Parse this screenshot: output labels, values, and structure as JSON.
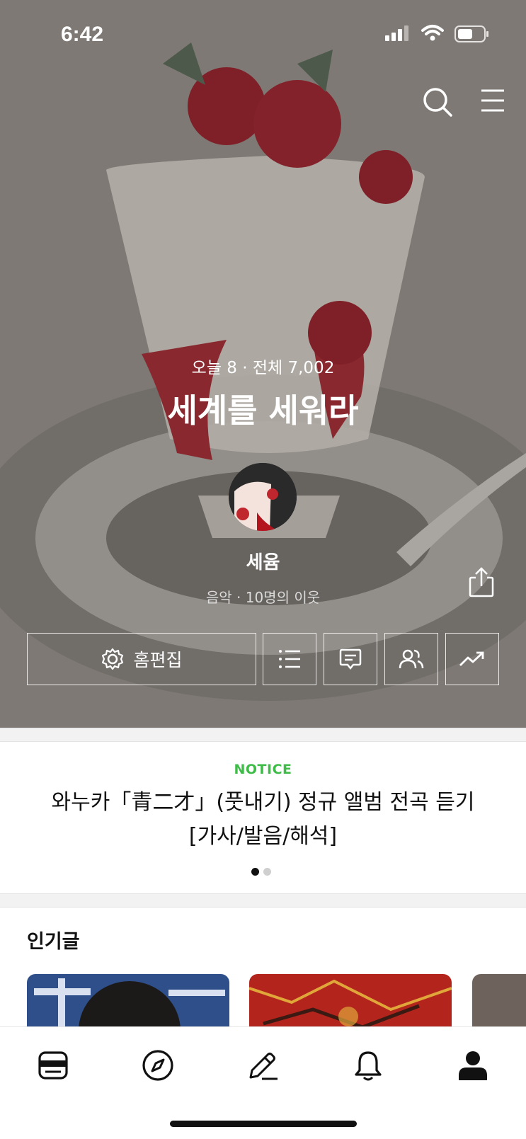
{
  "status_bar": {
    "time": "6:42"
  },
  "hero": {
    "stats": "오늘 8 · 전체 7,002",
    "blog_title": "세계를 세워라",
    "profile_name": "세윰",
    "profile_meta": "음악 · 10명의 이웃"
  },
  "actions": {
    "edit_label": "홈편집"
  },
  "notice": {
    "label": "NOTICE",
    "text": "와누카「青二才」(풋내기) 정규 앨범 전곡 듣기 [가사/발음/해석]",
    "page_total": 2,
    "page_current": 1
  },
  "popular": {
    "heading": "인기글"
  },
  "tabbar": {
    "items": [
      {
        "icon": "feed-icon"
      },
      {
        "icon": "compass-icon"
      },
      {
        "icon": "pencil-icon"
      },
      {
        "icon": "bell-icon"
      },
      {
        "icon": "profile-icon",
        "active": true
      }
    ]
  },
  "colors": {
    "notice_accent": "#3fbc48"
  }
}
